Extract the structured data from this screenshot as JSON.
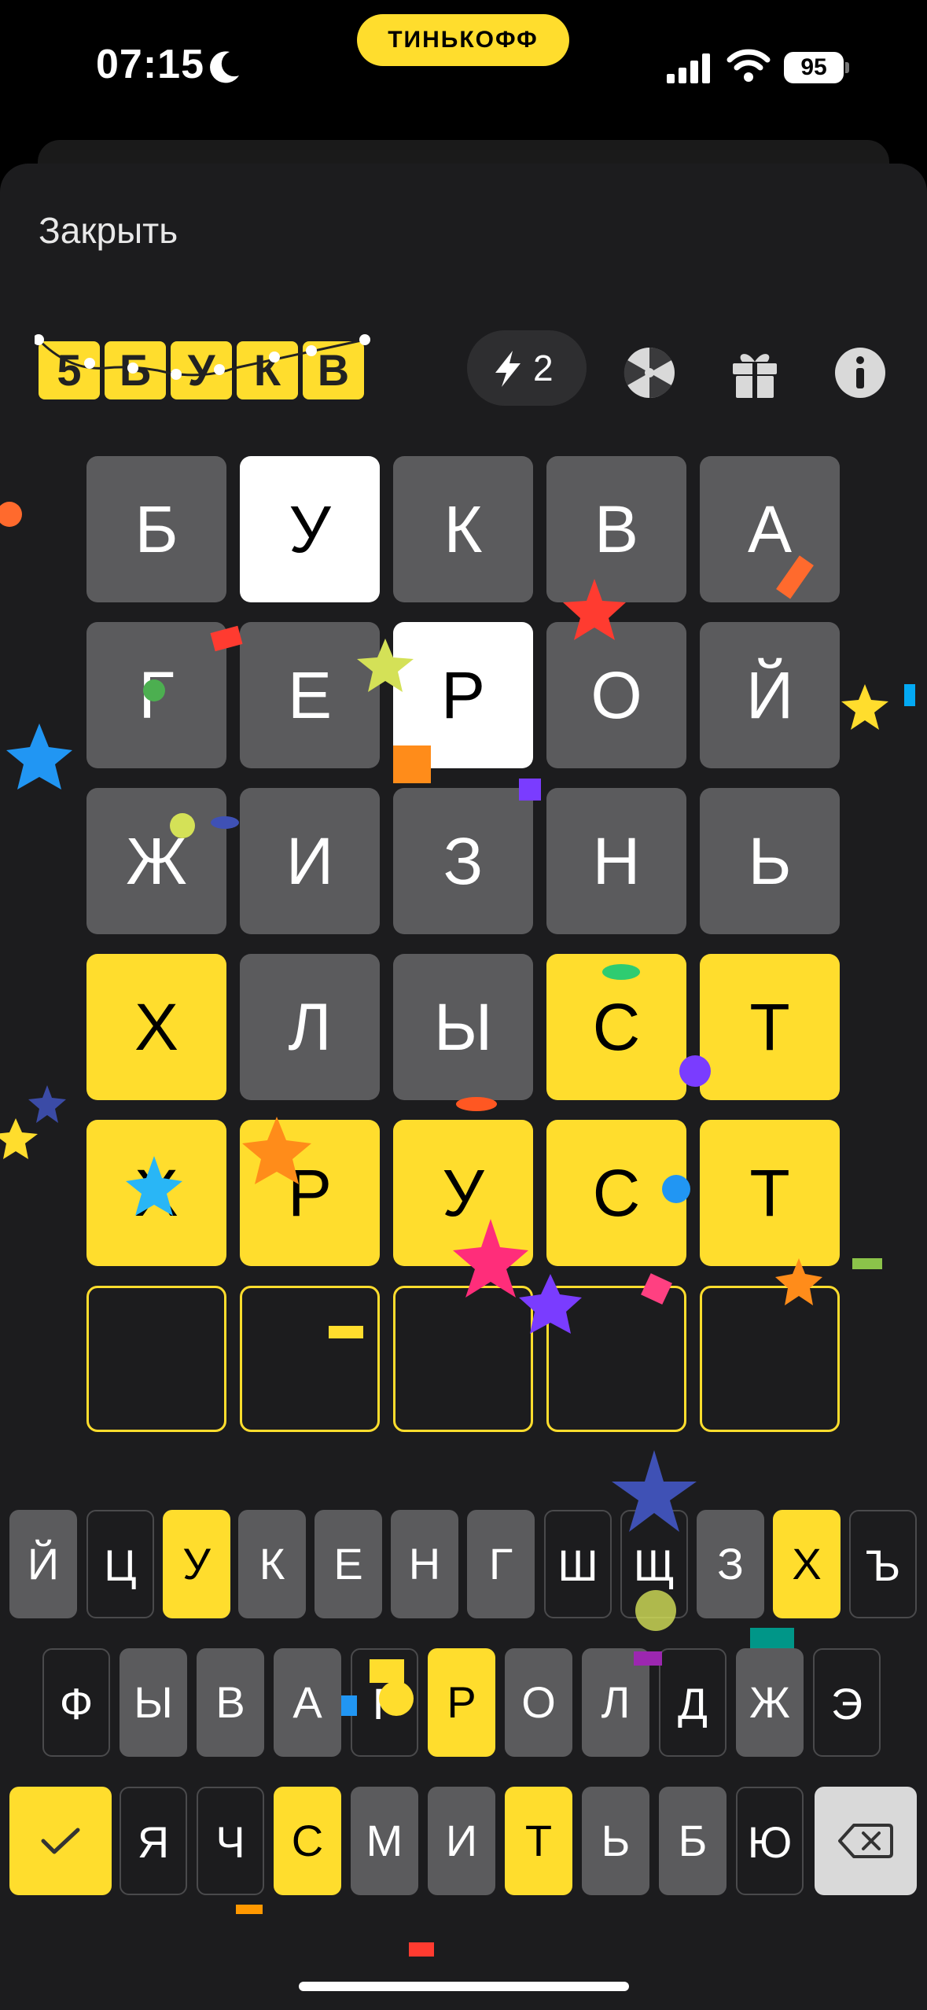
{
  "status_bar": {
    "time": "07:15",
    "bank_label": "ТИНЬКОФФ",
    "battery": "95"
  },
  "header": {
    "close_label": "Закрыть"
  },
  "logo": {
    "letters": [
      "5",
      "Б",
      "У",
      "К",
      "В"
    ]
  },
  "toolbar": {
    "energy_count": "2"
  },
  "board": {
    "rows": [
      [
        {
          "letter": "Б",
          "state": "gray"
        },
        {
          "letter": "У",
          "state": "white"
        },
        {
          "letter": "К",
          "state": "gray"
        },
        {
          "letter": "В",
          "state": "gray"
        },
        {
          "letter": "А",
          "state": "gray"
        }
      ],
      [
        {
          "letter": "Г",
          "state": "gray"
        },
        {
          "letter": "Е",
          "state": "gray"
        },
        {
          "letter": "Р",
          "state": "white"
        },
        {
          "letter": "О",
          "state": "gray"
        },
        {
          "letter": "Й",
          "state": "gray"
        }
      ],
      [
        {
          "letter": "Ж",
          "state": "gray"
        },
        {
          "letter": "И",
          "state": "gray"
        },
        {
          "letter": "З",
          "state": "gray"
        },
        {
          "letter": "Н",
          "state": "gray"
        },
        {
          "letter": "Ь",
          "state": "gray"
        }
      ],
      [
        {
          "letter": "Х",
          "state": "yellow"
        },
        {
          "letter": "Л",
          "state": "gray"
        },
        {
          "letter": "Ы",
          "state": "gray"
        },
        {
          "letter": "С",
          "state": "yellow"
        },
        {
          "letter": "Т",
          "state": "yellow"
        }
      ],
      [
        {
          "letter": "Х",
          "state": "yellow"
        },
        {
          "letter": "Р",
          "state": "yellow"
        },
        {
          "letter": "У",
          "state": "yellow"
        },
        {
          "letter": "С",
          "state": "yellow"
        },
        {
          "letter": "Т",
          "state": "yellow"
        }
      ],
      [
        {
          "letter": "",
          "state": "empty"
        },
        {
          "letter": "",
          "state": "empty"
        },
        {
          "letter": "",
          "state": "empty"
        },
        {
          "letter": "",
          "state": "empty"
        },
        {
          "letter": "",
          "state": "empty"
        }
      ]
    ]
  },
  "keyboard": {
    "rows": [
      [
        {
          "k": "Й",
          "s": "gray"
        },
        {
          "k": "Ц",
          "s": "dark"
        },
        {
          "k": "У",
          "s": "yellow"
        },
        {
          "k": "К",
          "s": "gray"
        },
        {
          "k": "Е",
          "s": "gray"
        },
        {
          "k": "Н",
          "s": "gray"
        },
        {
          "k": "Г",
          "s": "gray"
        },
        {
          "k": "Ш",
          "s": "dark"
        },
        {
          "k": "Щ",
          "s": "dark"
        },
        {
          "k": "З",
          "s": "gray"
        },
        {
          "k": "Х",
          "s": "yellow"
        },
        {
          "k": "Ъ",
          "s": "dark"
        }
      ],
      [
        {
          "k": "Ф",
          "s": "dark"
        },
        {
          "k": "Ы",
          "s": "gray"
        },
        {
          "k": "В",
          "s": "gray"
        },
        {
          "k": "А",
          "s": "gray"
        },
        {
          "k": "Г",
          "s": "dark"
        },
        {
          "k": "Р",
          "s": "yellow"
        },
        {
          "k": "О",
          "s": "gray"
        },
        {
          "k": "Л",
          "s": "gray"
        },
        {
          "k": "Д",
          "s": "dark"
        },
        {
          "k": "Ж",
          "s": "gray"
        },
        {
          "k": "Э",
          "s": "dark"
        }
      ],
      [
        {
          "k": "Я",
          "s": "dark"
        },
        {
          "k": "Ч",
          "s": "dark"
        },
        {
          "k": "С",
          "s": "yellow"
        },
        {
          "k": "М",
          "s": "gray"
        },
        {
          "k": "И",
          "s": "gray"
        },
        {
          "k": "Т",
          "s": "yellow"
        },
        {
          "k": "Ь",
          "s": "gray"
        },
        {
          "k": "Б",
          "s": "gray"
        },
        {
          "k": "Ю",
          "s": "dark"
        }
      ]
    ],
    "submit_icon": "checkmark-icon",
    "backspace_icon": "backspace-icon"
  },
  "colors": {
    "accent": "#ffdd2d",
    "tile_gray": "#5b5b5d",
    "background": "#1c1c1e"
  }
}
